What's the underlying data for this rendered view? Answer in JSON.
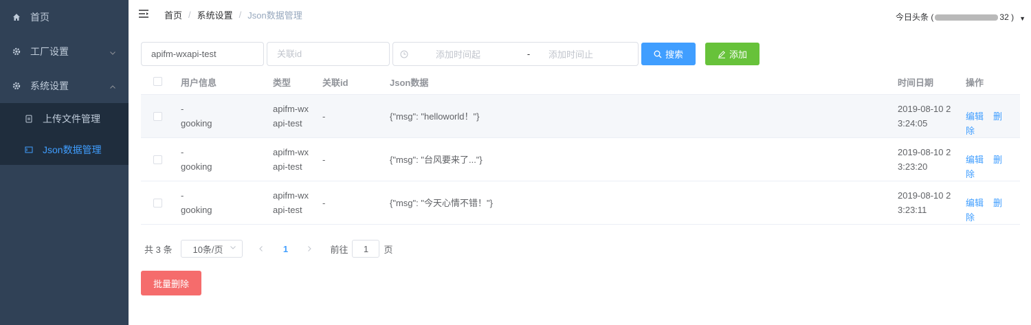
{
  "sidebar": {
    "items": [
      {
        "label": "首页",
        "icon": "home-icon"
      },
      {
        "label": "工厂设置",
        "icon": "gear-icon",
        "expanded": false
      },
      {
        "label": "系统设置",
        "icon": "gear-icon",
        "expanded": true
      }
    ],
    "subitems": [
      {
        "label": "上传文件管理",
        "icon": "upload-file-icon",
        "active": false
      },
      {
        "label": "Json数据管理",
        "icon": "json-data-icon",
        "active": true
      }
    ]
  },
  "navbar": {
    "breadcrumb": [
      "首页",
      "系统设置",
      "Json数据管理"
    ],
    "breadcrumb_sep": "/",
    "user_prefix": "今日头条 (",
    "user_suffix": "32 )"
  },
  "filters": {
    "type_value": "apifm-wxapi-test",
    "rel_placeholder": "关联id",
    "date_start_placeholder": "添加时间起",
    "date_sep": "-",
    "date_end_placeholder": "添加时间止",
    "search_label": "搜索",
    "add_label": "添加"
  },
  "table": {
    "headers": {
      "user": "用户信息",
      "type": "类型",
      "rel": "关联id",
      "json": "Json数据",
      "time": "时间日期",
      "op": "操作"
    },
    "rows": [
      {
        "user1": "-",
        "user2": "gooking",
        "type1": "apifm-wx",
        "type2": "api-test",
        "rel": "-",
        "json": "{\"msg\": \"helloworld！\"}",
        "time1": "2019-08-10 2",
        "time2": "3:24:05"
      },
      {
        "user1": "-",
        "user2": "gooking",
        "type1": "apifm-wx",
        "type2": "api-test",
        "rel": "-",
        "json": "{\"msg\": \"台风要来了...\"}",
        "time1": "2019-08-10 2",
        "time2": "3:23:20"
      },
      {
        "user1": "-",
        "user2": "gooking",
        "type1": "apifm-wx",
        "type2": "api-test",
        "rel": "-",
        "json": "{\"msg\": \"今天心情不错！\"}",
        "time1": "2019-08-10 2",
        "time2": "3:23:11"
      }
    ],
    "edit_label": "编辑",
    "delete_label": "删除"
  },
  "pagination": {
    "total": "共 3 条",
    "page_size": "10条/页",
    "current_page": "1",
    "goto_label": "前往",
    "goto_value": "1",
    "page_suffix": "页"
  },
  "batch_delete_label": "批量删除",
  "colors": {
    "sidebar_bg": "#304156",
    "submenu_bg": "#1f2d3d",
    "primary": "#409eff",
    "success": "#67c23a",
    "danger": "#f56c6c"
  }
}
